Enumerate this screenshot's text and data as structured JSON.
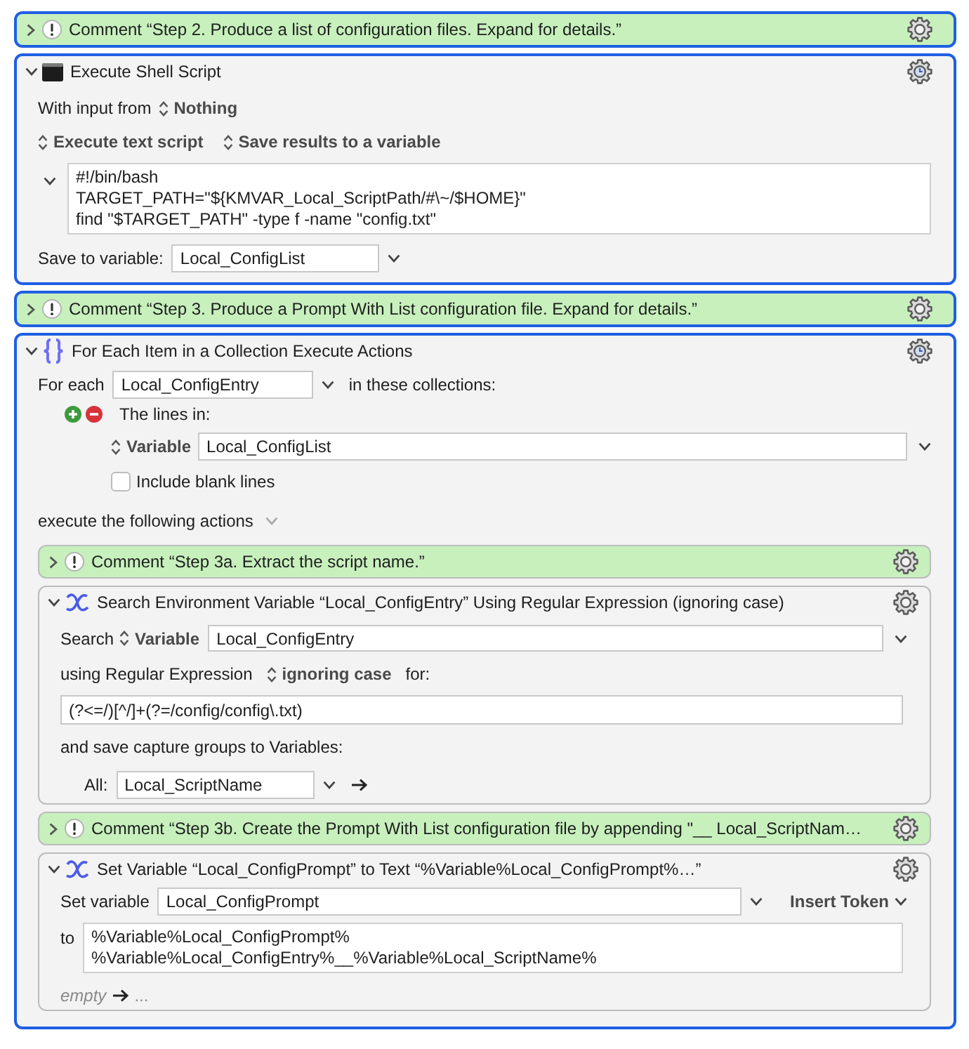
{
  "actions": [
    {
      "kind": "comment",
      "selected": true,
      "expanded": false,
      "title": "Comment “Step 2. Produce a list of configuration files. Expand for details.”"
    },
    {
      "kind": "shell",
      "selected": true,
      "expanded": true,
      "timer": true,
      "title": "Execute Shell Script",
      "input_label": "With input from",
      "input_source": "Nothing",
      "mode": "Execute text script",
      "output": "Save results to a variable",
      "script": [
        "#!/bin/bash",
        "TARGET_PATH=\"${KMVAR_Local_ScriptPath/#\\~/$HOME}\"",
        "find \"$TARGET_PATH\" -type f -name \"config.txt\""
      ],
      "save_label": "Save to variable:",
      "save_value": "Local_ConfigList"
    },
    {
      "kind": "comment",
      "selected": true,
      "expanded": false,
      "title": "Comment “Step 3. Produce a Prompt With List configuration file. Expand for details.”"
    },
    {
      "kind": "for_each",
      "selected": true,
      "expanded": true,
      "timer": true,
      "title": "For Each Item in a Collection Execute Actions",
      "for_label": "For each",
      "variable": "Local_ConfigEntry",
      "collections_label": "in these collections:",
      "collection": {
        "title": "The lines in:",
        "source_kind": "Variable",
        "source": "Local_ConfigList",
        "option": {
          "label": "Include blank lines",
          "checked": false
        }
      },
      "execute_label": "execute the following actions",
      "actions": [
        {
          "kind": "comment",
          "selected": false,
          "expanded": false,
          "title": "Comment “Step 3a. Extract the script name.”"
        },
        {
          "kind": "search_regex",
          "selected": false,
          "expanded": true,
          "timer": false,
          "title": "Search Environment Variable “Local_ConfigEntry” Using Regular Expression (ignoring case)",
          "search_label": "Search",
          "source_kind": "Variable",
          "source": "Local_ConfigEntry",
          "regex_label": "using Regular Expression",
          "case": "ignoring case",
          "for_label": "for:",
          "pattern": "(?<=/)[^/]+(?=/config/config\\.txt)",
          "capture_label": "and save capture groups to Variables:",
          "captures": [
            {
              "label": "All:",
              "value": "Local_ScriptName"
            }
          ]
        },
        {
          "kind": "comment",
          "selected": false,
          "expanded": false,
          "title": "Comment “Step 3b. Create the Prompt With List configuration file by appending \"__ Local_ScriptNam…"
        },
        {
          "kind": "set_variable",
          "selected": false,
          "expanded": true,
          "timer": false,
          "title": "Set Variable “Local_ConfigPrompt” to Text “%Variable%Local_ConfigPrompt%…”",
          "set_label": "Set variable",
          "variable": "Local_ConfigPrompt",
          "token_button": "Insert Token",
          "to_label": "to",
          "text": [
            "%Variable%Local_ConfigPrompt%",
            "%Variable%Local_ConfigEntry%__%Variable%Local_ScriptName%"
          ],
          "footer_label": "empty",
          "footer_more": "..."
        }
      ]
    }
  ]
}
